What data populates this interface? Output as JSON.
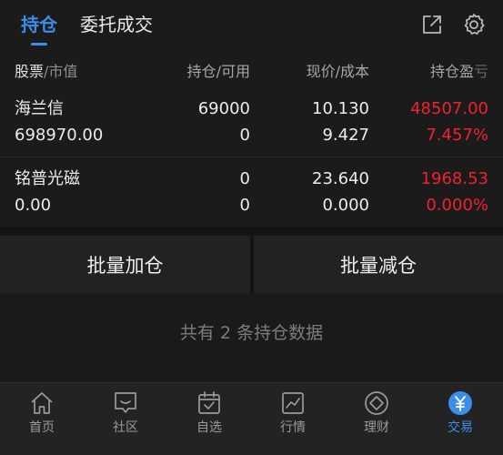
{
  "tabs": {
    "active": "持仓",
    "inactive": "委托成交"
  },
  "icons": {
    "share": "share-icon",
    "settings": "gear-icon"
  },
  "table": {
    "headers": {
      "name_main": "股票",
      "name_sep": "/",
      "name_sub": "市值",
      "position": "持仓/可用",
      "price": "现价/成本",
      "pl_main": "持仓盈",
      "pl_faded": "亏"
    },
    "rows": [
      {
        "name": "海兰信",
        "market_value": "698970.00",
        "holding": "69000",
        "available": "0",
        "price": "10.130",
        "cost": "9.427",
        "pl": "48507.00",
        "pl_pct": "7.457%"
      },
      {
        "name": "铭普光磁",
        "market_value": "0.00",
        "holding": "0",
        "available": "0",
        "price": "23.640",
        "cost": "0.000",
        "pl": "1968.53",
        "pl_pct": "0.000%"
      }
    ]
  },
  "actions": {
    "add": "批量加仓",
    "reduce": "批量减仓"
  },
  "summary": "共有 2 条持仓数据",
  "nav": {
    "items": [
      {
        "label": "首页",
        "icon": "home-icon"
      },
      {
        "label": "社区",
        "icon": "chat-icon"
      },
      {
        "label": "自选",
        "icon": "watchlist-icon"
      },
      {
        "label": "行情",
        "icon": "chart-icon"
      },
      {
        "label": "理财",
        "icon": "diamond-icon"
      },
      {
        "label": "交易",
        "icon": "yen-icon"
      }
    ],
    "active_index": 5
  },
  "colors": {
    "accent": "#3d8ee8",
    "profit": "#f0222f",
    "background": "#141414"
  }
}
